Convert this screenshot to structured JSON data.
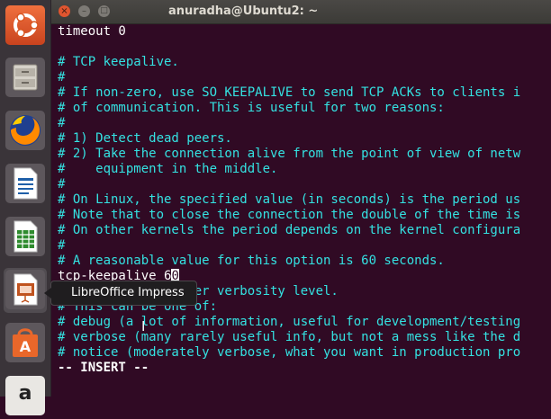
{
  "window": {
    "title": "anuradha@Ubuntu2: ~",
    "close_glyph": "×",
    "minimize_glyph": "–",
    "maximize_glyph": "□"
  },
  "launcher": {
    "items": [
      {
        "name": "Ubuntu Dash",
        "icon": "ubuntu-logo-icon",
        "color": "#e95420"
      },
      {
        "name": "Files",
        "icon": "file-cabinet-icon",
        "color": "#c9c5bc"
      },
      {
        "name": "Firefox",
        "icon": "firefox-icon",
        "color": "#ff8a00"
      },
      {
        "name": "LibreOffice Writer",
        "icon": "writer-icon",
        "color": "#1e5fa8"
      },
      {
        "name": "LibreOffice Calc",
        "icon": "calc-icon",
        "color": "#2e8b2e"
      },
      {
        "name": "LibreOffice Impress",
        "icon": "impress-icon",
        "color": "#c0531f"
      },
      {
        "name": "Ubuntu Software",
        "icon": "software-bag-icon",
        "color": "#e9672a"
      },
      {
        "name": "Amazon",
        "icon": "amazon-icon",
        "color": "#ffffff"
      }
    ]
  },
  "tooltip": {
    "text": "LibreOffice Impress"
  },
  "terminal": {
    "lines": [
      {
        "text": "timeout 0",
        "type": "text"
      },
      {
        "text": "",
        "type": "text"
      },
      {
        "text": "# TCP keepalive.",
        "type": "comment"
      },
      {
        "text": "#",
        "type": "comment"
      },
      {
        "text": "# If non-zero, use SO_KEEPALIVE to send TCP ACKs to clients i",
        "type": "comment"
      },
      {
        "text": "# of communication. This is useful for two reasons:",
        "type": "comment"
      },
      {
        "text": "#",
        "type": "comment"
      },
      {
        "text": "# 1) Detect dead peers.",
        "type": "comment"
      },
      {
        "text": "# 2) Take the connection alive from the point of view of netw",
        "type": "comment"
      },
      {
        "text": "#    equipment in the middle.",
        "type": "comment"
      },
      {
        "text": "#",
        "type": "comment"
      },
      {
        "text": "# On Linux, the specified value (in seconds) is the period us",
        "type": "comment"
      },
      {
        "text": "# Note that to close the connection the double of the time is",
        "type": "comment"
      },
      {
        "text": "# On other kernels the period depends on the kernel configura",
        "type": "comment"
      },
      {
        "text": "#",
        "type": "comment"
      },
      {
        "text": "# A reasonable value for this option is 60 seconds.",
        "type": "comment"
      },
      {
        "text": "tcp-keepalive 6",
        "type": "text",
        "cursor": "0"
      },
      {
        "text": "# Specify the server verbosity level.",
        "type": "comment"
      },
      {
        "text": "# This can be one of:",
        "type": "comment"
      },
      {
        "text": "# debug (a lot of information, useful for development/testing",
        "type": "comment"
      },
      {
        "text": "# verbose (many rarely useful info, but not a mess like the d",
        "type": "comment"
      },
      {
        "text": "# notice (moderately verbose, what you want in production pro",
        "type": "comment"
      }
    ],
    "mode": "-- INSERT --"
  }
}
